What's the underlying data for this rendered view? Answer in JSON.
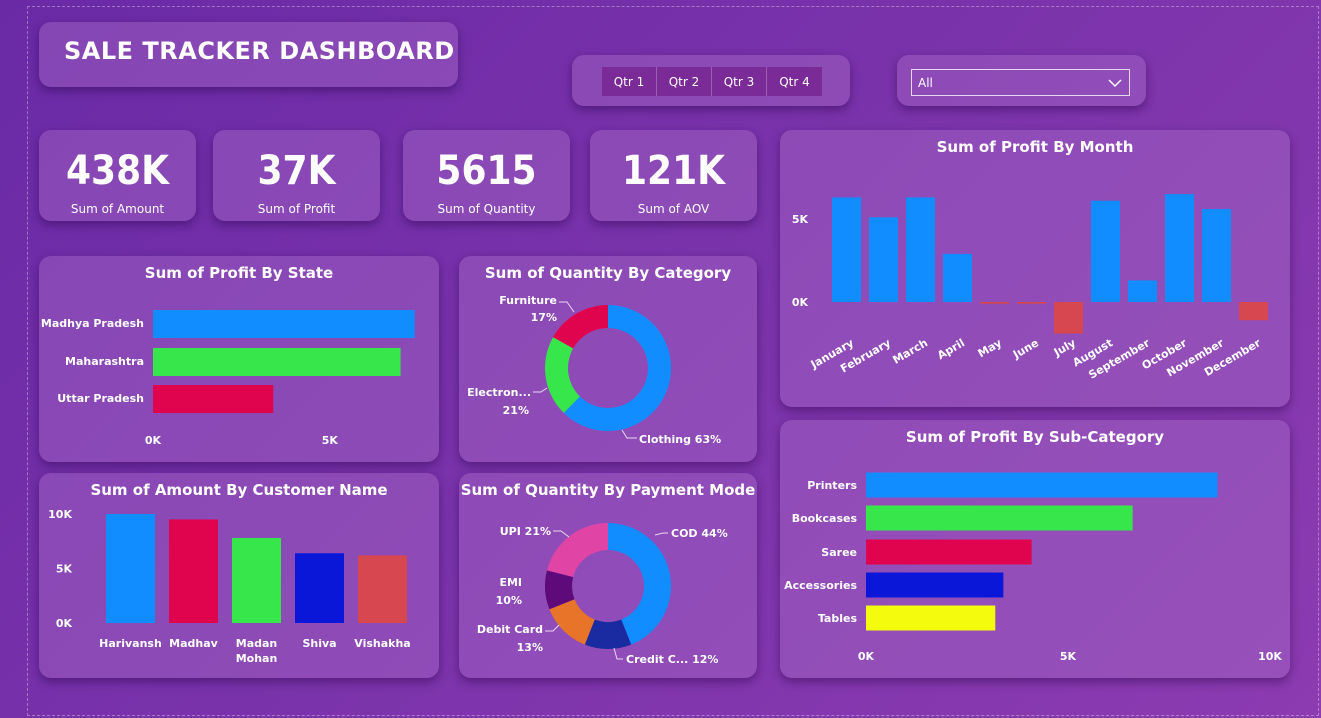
{
  "header": {
    "title": "SALE TRACKER DASHBOARD",
    "quarters": [
      "Qtr 1",
      "Qtr 2",
      "Qtr 3",
      "Qtr 4"
    ],
    "dropdown_value": "All"
  },
  "kpis": [
    {
      "value": "438K",
      "label": "Sum of Amount"
    },
    {
      "value": "37K",
      "label": "Sum of Profit"
    },
    {
      "value": "5615",
      "label": "Sum of Quantity"
    },
    {
      "value": "121K",
      "label": "Sum of AOV"
    }
  ],
  "colors": {
    "blue": "#118dff",
    "green": "#37e64a",
    "red": "#e0044e",
    "navy": "#0a16d8",
    "salmon": "#d6474f",
    "yellow": "#f5fb0c",
    "purple": "#5e0a7a",
    "orange": "#e8742a",
    "pink": "#e045a6",
    "darkblue": "#1a2aa0"
  },
  "chart_data": [
    {
      "type": "bar",
      "orientation": "horizontal",
      "title": "Sum of Profit By State",
      "categories": [
        "Madhya Pradesh",
        "Maharashtra",
        "Uttar Pradesh"
      ],
      "values": [
        7400,
        7000,
        3400
      ],
      "ticks": [
        "0K",
        "5K"
      ],
      "xlim": [
        0,
        8200
      ]
    },
    {
      "type": "pie",
      "title": "Sum of Quantity By Category",
      "slices": [
        {
          "name": "Clothing",
          "value": 63,
          "label": "Clothing 63%"
        },
        {
          "name": "Electronics",
          "value": 21,
          "label": "Electron...",
          "pct": "21%"
        },
        {
          "name": "Furniture",
          "value": 17,
          "label": "Furniture",
          "pct": "17%"
        }
      ]
    },
    {
      "type": "bar",
      "title": "Sum of Profit By Month",
      "categories": [
        "January",
        "February",
        "March",
        "April",
        "May",
        "June",
        "July",
        "August",
        "September",
        "October",
        "November",
        "December"
      ],
      "values": [
        6300,
        5100,
        6300,
        2900,
        -100,
        -100,
        -1900,
        6100,
        1300,
        6500,
        5600,
        -1100
      ],
      "ticks": [
        "5K",
        "0K"
      ],
      "ylim": [
        -2500,
        7500
      ]
    },
    {
      "type": "bar",
      "title": "Sum of Amount By Customer Name",
      "categories": [
        "Harivansh",
        "Madhav",
        "Madan Mohan",
        "Shiva",
        "Vishakha"
      ],
      "category_lines": [
        [
          "Harivansh"
        ],
        [
          "Madhav"
        ],
        [
          "Madan",
          "Mohan"
        ],
        [
          "Shiva"
        ],
        [
          "Vishakha"
        ]
      ],
      "values": [
        10000,
        9500,
        7800,
        6400,
        6200
      ],
      "ticks": [
        "10K",
        "5K",
        "0K"
      ],
      "ylim": [
        0,
        10000
      ]
    },
    {
      "type": "pie",
      "title": "Sum of Quantity By Payment Mode",
      "slices": [
        {
          "name": "COD",
          "value": 44,
          "label": "COD 44%"
        },
        {
          "name": "Credit Card",
          "value": 12,
          "label": "Credit C... 12%"
        },
        {
          "name": "Debit Card",
          "value": 13,
          "label": "Debit Card",
          "pct": "13%"
        },
        {
          "name": "EMI",
          "value": 10,
          "label": "EMI",
          "pct": "10%"
        },
        {
          "name": "UPI",
          "value": 21,
          "label": "UPI 21%"
        }
      ]
    },
    {
      "type": "bar",
      "orientation": "horizontal",
      "title": "Sum of Profit By Sub-Category",
      "categories": [
        "Printers",
        "Bookcases",
        "Saree",
        "Accessories",
        "Tables"
      ],
      "values": [
        8700,
        6600,
        4100,
        3400,
        3200
      ],
      "ticks": [
        "0K",
        "5K",
        "10K"
      ],
      "xlim": [
        0,
        10000
      ]
    }
  ]
}
